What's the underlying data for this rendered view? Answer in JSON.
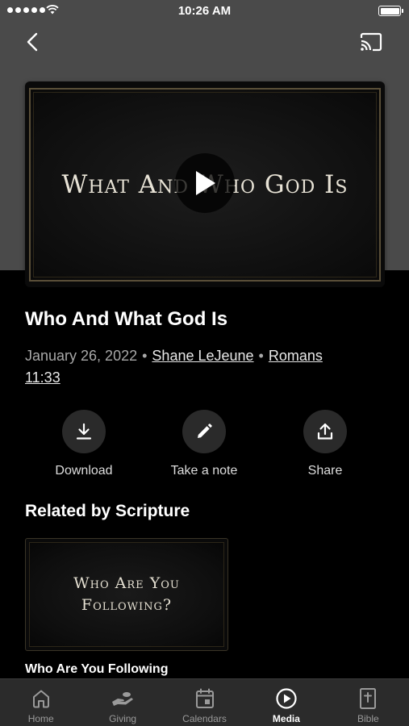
{
  "status_bar": {
    "time": "10:26 AM"
  },
  "video": {
    "overlay_title": "What And Who God Is",
    "play_label": "play-icon"
  },
  "sermon": {
    "title": "Who And What God Is",
    "date": "January 26, 2022",
    "speaker": "Shane LeJeune",
    "scripture_line1": "Romans",
    "scripture_line2": "11:33",
    "separator": "•"
  },
  "actions": [
    {
      "label": "Download",
      "icon": "download-icon"
    },
    {
      "label": "Take a note",
      "icon": "pencil-icon"
    },
    {
      "label": "Share",
      "icon": "share-icon"
    }
  ],
  "related": {
    "heading": "Related by Scripture",
    "items": [
      {
        "thumb_line1": "Who Are You",
        "thumb_line2": "Following?",
        "caption": "Who Are You Following"
      }
    ]
  },
  "tabbar": {
    "items": [
      {
        "label": "Home",
        "icon": "home-icon",
        "active": false
      },
      {
        "label": "Giving",
        "icon": "giving-icon",
        "active": false
      },
      {
        "label": "Calendars",
        "icon": "calendar-icon",
        "active": false
      },
      {
        "label": "Media",
        "icon": "media-play-icon",
        "active": true
      },
      {
        "label": "Bible",
        "icon": "bible-icon",
        "active": false
      }
    ]
  },
  "colors": {
    "hero_background": "#4a4a4a",
    "page_background": "#000000",
    "tabbar_background": "#2b2b2b",
    "action_circle": "#2a2a2a"
  }
}
